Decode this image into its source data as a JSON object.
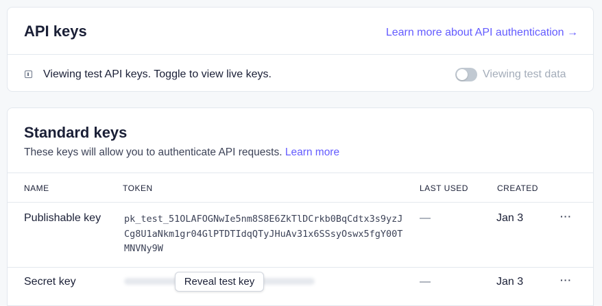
{
  "api_keys": {
    "title": "API keys",
    "learn_link": "Learn more about API authentication →",
    "info_text": "Viewing test API keys. Toggle to view live keys.",
    "toggle": {
      "label": "Viewing test data",
      "on": false
    }
  },
  "standard_keys": {
    "title": "Standard keys",
    "subtitle": "These keys will allow you to authenticate API requests.",
    "subtitle_link": "Learn more",
    "columns": [
      "NAME",
      "TOKEN",
      "LAST USED",
      "CREATED"
    ],
    "rows": [
      {
        "name": "Publishable key",
        "token": "pk_test_51OLAFOGNwIe5nm8S8E6ZkTlDCrkb0BqCdtx3s9yzJCg8U1aNkm1gr04GlPTDTIdqQTyJHuAv31x6SSsyOswx5fgY00TMNVNy9W",
        "last_used": "—",
        "created": "Jan 3",
        "menu": "···"
      },
      {
        "name": "Secret key",
        "reveal_label": "Reveal test key",
        "last_used": "—",
        "created": "Jan 3",
        "menu": "···"
      }
    ]
  },
  "colors": {
    "accent": "#635bff",
    "toggle_off": "#c1c9d2",
    "border": "#e3e8ee"
  },
  "icons": {
    "info": "info-icon",
    "arrow": "arrow-right-icon",
    "more": "more-horizontal-icon"
  }
}
